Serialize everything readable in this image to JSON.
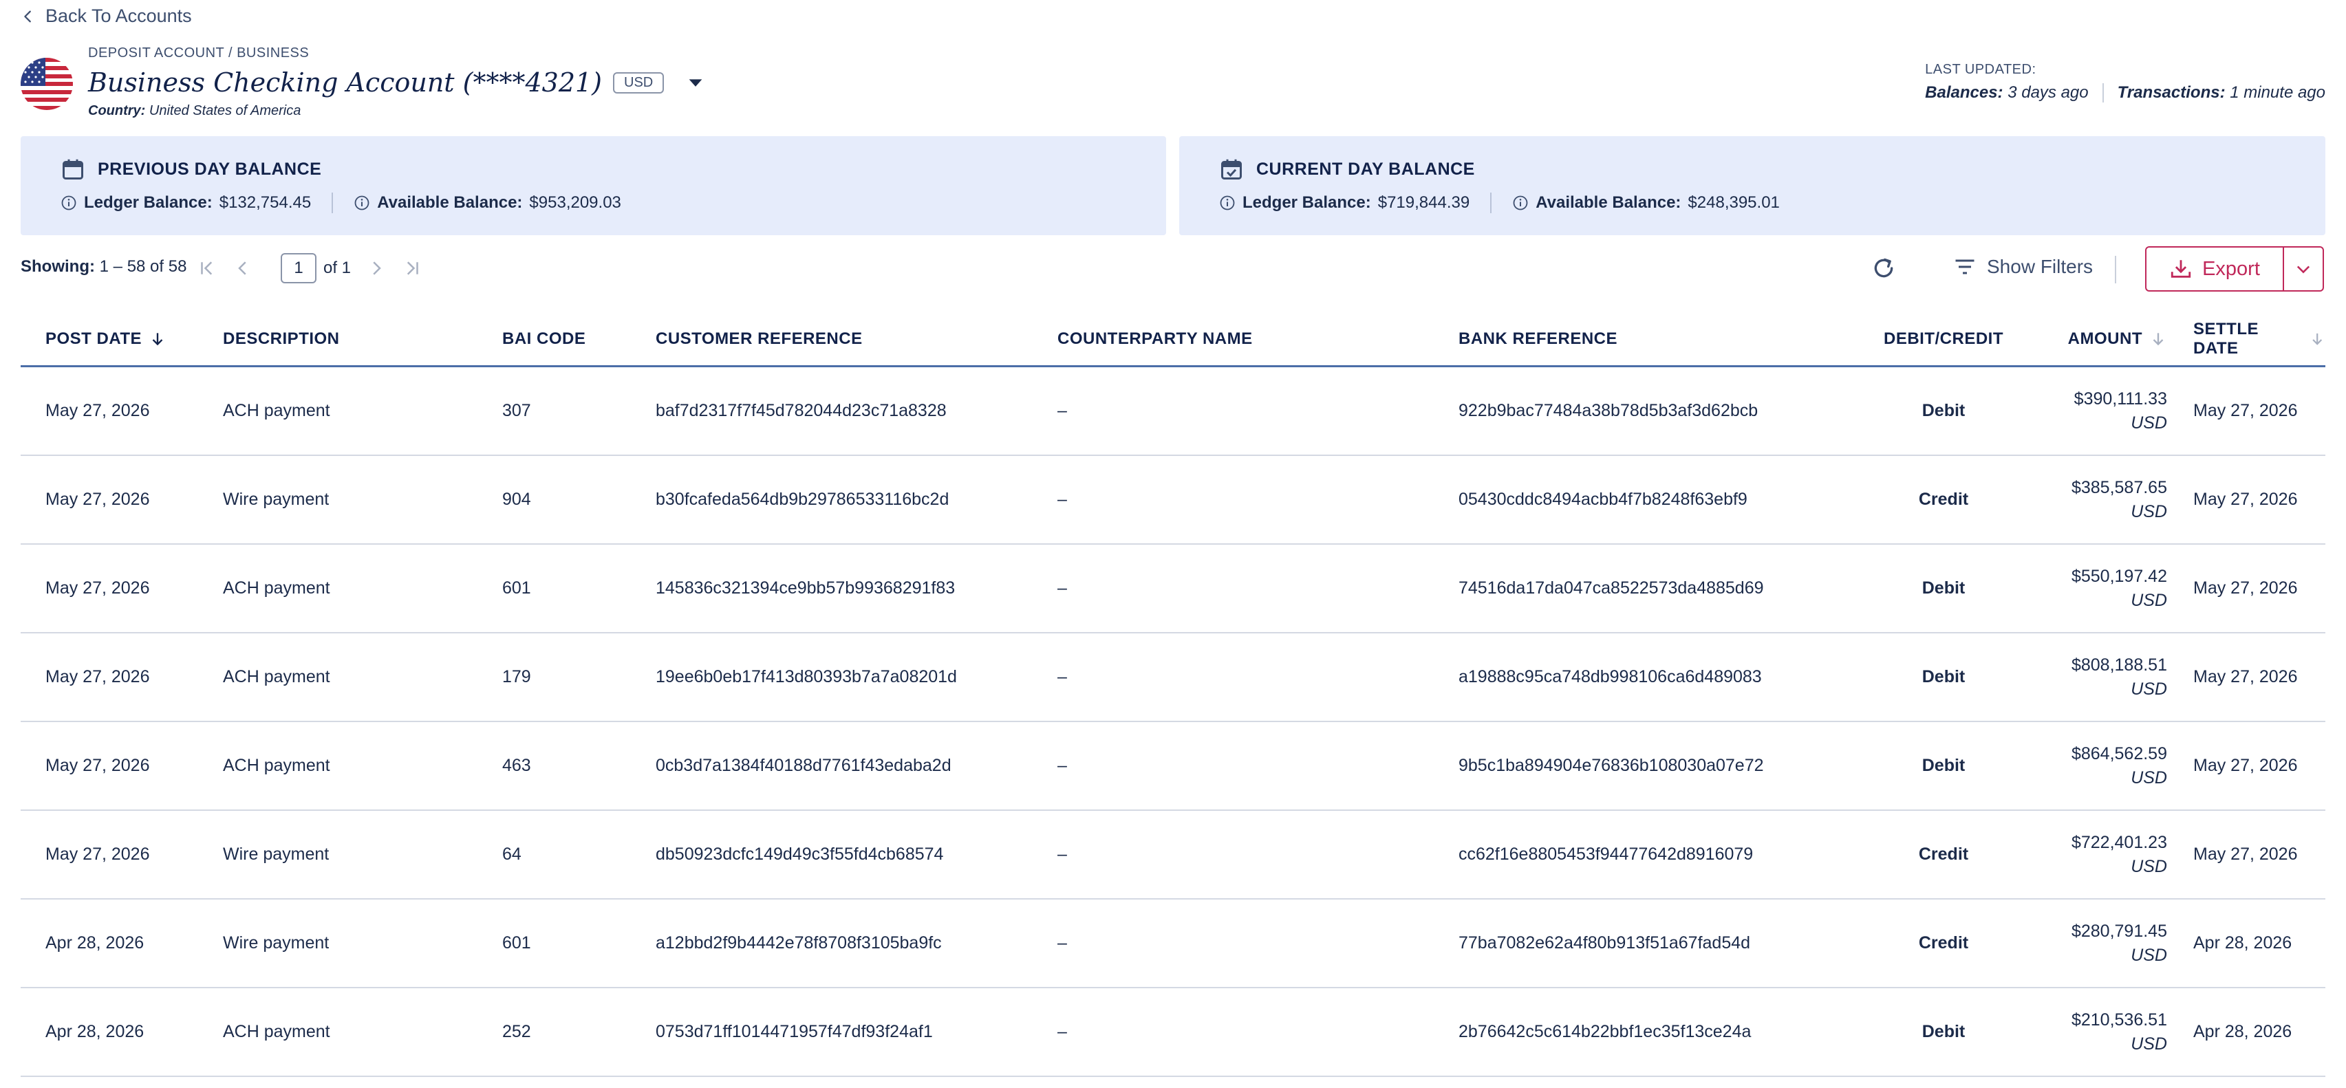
{
  "nav": {
    "back_label": "Back To Accounts"
  },
  "account": {
    "breadcrumb": "DEPOSIT ACCOUNT / BUSINESS",
    "name": "Business Checking Account (****4321)",
    "currency": "USD",
    "country_label": "Country:",
    "country_value": "United States of America"
  },
  "updated": {
    "label": "LAST UPDATED:",
    "balances_label": "Balances:",
    "balances_value": "3 days ago",
    "transactions_label": "Transactions:",
    "transactions_value": "1 minute ago"
  },
  "previous_day": {
    "title": "PREVIOUS DAY BALANCE",
    "ledger_label": "Ledger Balance:",
    "ledger_value": "$132,754.45",
    "available_label": "Available Balance:",
    "available_value": "$953,209.03"
  },
  "current_day": {
    "title": "CURRENT DAY BALANCE",
    "ledger_label": "Ledger Balance:",
    "ledger_value": "$719,844.39",
    "available_label": "Available Balance:",
    "available_value": "$248,395.01"
  },
  "toolbar": {
    "showing_label": "Showing:",
    "showing_value": "1 – 58 of 58",
    "page_value": "1",
    "page_of": "of 1",
    "show_filters": "Show Filters",
    "export": "Export"
  },
  "table": {
    "columns": {
      "post_date": "POST DATE",
      "description": "DESCRIPTION",
      "bai_code": "BAI CODE",
      "customer_reference": "CUSTOMER REFERENCE",
      "counterparty_name": "COUNTERPARTY NAME",
      "bank_reference": "BANK REFERENCE",
      "debit_credit": "DEBIT/CREDIT",
      "amount": "AMOUNT",
      "settle_date": "SETTLE DATE"
    },
    "rows": [
      {
        "post_date": "May 27, 2026",
        "description": "ACH payment",
        "bai_code": "307",
        "customer_reference": "baf7d2317f7f45d782044d23c71a8328",
        "counterparty": "–",
        "bank_reference": "922b9bac77484a38b78d5b3af3d62bcb",
        "debit_credit": "Debit",
        "amount": "$390,111.33",
        "currency": "USD",
        "settle_date": "May 27, 2026"
      },
      {
        "post_date": "May 27, 2026",
        "description": "Wire payment",
        "bai_code": "904",
        "customer_reference": "b30fcafeda564db9b29786533116bc2d",
        "counterparty": "–",
        "bank_reference": "05430cddc8494acbb4f7b8248f63ebf9",
        "debit_credit": "Credit",
        "amount": "$385,587.65",
        "currency": "USD",
        "settle_date": "May 27, 2026"
      },
      {
        "post_date": "May 27, 2026",
        "description": "ACH payment",
        "bai_code": "601",
        "customer_reference": "145836c321394ce9bb57b99368291f83",
        "counterparty": "–",
        "bank_reference": "74516da17da047ca8522573da4885d69",
        "debit_credit": "Debit",
        "amount": "$550,197.42",
        "currency": "USD",
        "settle_date": "May 27, 2026"
      },
      {
        "post_date": "May 27, 2026",
        "description": "ACH payment",
        "bai_code": "179",
        "customer_reference": "19ee6b0eb17f413d80393b7a7a08201d",
        "counterparty": "–",
        "bank_reference": "a19888c95ca748db998106ca6d489083",
        "debit_credit": "Debit",
        "amount": "$808,188.51",
        "currency": "USD",
        "settle_date": "May 27, 2026"
      },
      {
        "post_date": "May 27, 2026",
        "description": "ACH payment",
        "bai_code": "463",
        "customer_reference": "0cb3d7a1384f40188d7761f43edaba2d",
        "counterparty": "–",
        "bank_reference": "9b5c1ba894904e76836b108030a07e72",
        "debit_credit": "Debit",
        "amount": "$864,562.59",
        "currency": "USD",
        "settle_date": "May 27, 2026"
      },
      {
        "post_date": "May 27, 2026",
        "description": "Wire payment",
        "bai_code": "64",
        "customer_reference": "db50923dcfc149d49c3f55fd4cb68574",
        "counterparty": "–",
        "bank_reference": "cc62f16e8805453f94477642d8916079",
        "debit_credit": "Credit",
        "amount": "$722,401.23",
        "currency": "USD",
        "settle_date": "May 27, 2026"
      },
      {
        "post_date": "Apr 28, 2026",
        "description": "Wire payment",
        "bai_code": "601",
        "customer_reference": "a12bbd2f9b4442e78f8708f3105ba9fc",
        "counterparty": "–",
        "bank_reference": "77ba7082e62a4f80b913f51a67fad54d",
        "debit_credit": "Credit",
        "amount": "$280,791.45",
        "currency": "USD",
        "settle_date": "Apr 28, 2026"
      },
      {
        "post_date": "Apr 28, 2026",
        "description": "ACH payment",
        "bai_code": "252",
        "customer_reference": "0753d71ff1014471957f47df93f24af1",
        "counterparty": "–",
        "bank_reference": "2b76642c5c614b22bbf1ec35f13ce24a",
        "debit_credit": "Debit",
        "amount": "$210,536.51",
        "currency": "USD",
        "settle_date": "Apr 28, 2026"
      }
    ]
  },
  "colors": {
    "accent": "#c0285a",
    "navy": "#12224a",
    "card_bg": "#e6ecfb",
    "header_rule": "#4b6ea8"
  }
}
